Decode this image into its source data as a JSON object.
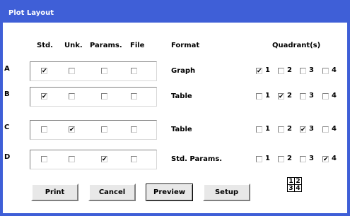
{
  "window": {
    "title": "Plot Layout"
  },
  "headers": {
    "std": "Std.",
    "unk": "Unk.",
    "params": "Params.",
    "file": "File",
    "format": "Format",
    "quadrants": "Quadrant(s)"
  },
  "rows": [
    {
      "label": "A",
      "std": true,
      "unk": false,
      "params": false,
      "file": false,
      "format": "Graph",
      "quadrants": [
        true,
        false,
        false,
        false
      ]
    },
    {
      "label": "B",
      "std": true,
      "unk": false,
      "params": false,
      "file": false,
      "format": "Table",
      "quadrants": [
        false,
        true,
        false,
        false
      ]
    },
    {
      "label": "C",
      "std": false,
      "unk": true,
      "params": false,
      "file": false,
      "format": "Table",
      "quadrants": [
        false,
        false,
        true,
        false
      ]
    },
    {
      "label": "D",
      "std": false,
      "unk": false,
      "params": true,
      "file": false,
      "format": "Std. Params.",
      "quadrants": [
        false,
        false,
        false,
        true
      ]
    }
  ],
  "quadrant_labels": [
    "1",
    "2",
    "3",
    "4"
  ],
  "buttons": {
    "print": "Print",
    "cancel": "Cancel",
    "preview": "Preview",
    "setup": "Setup"
  },
  "quadrant_icon": {
    "q1": "1",
    "q2": "2",
    "q3": "3",
    "q4": "4"
  }
}
